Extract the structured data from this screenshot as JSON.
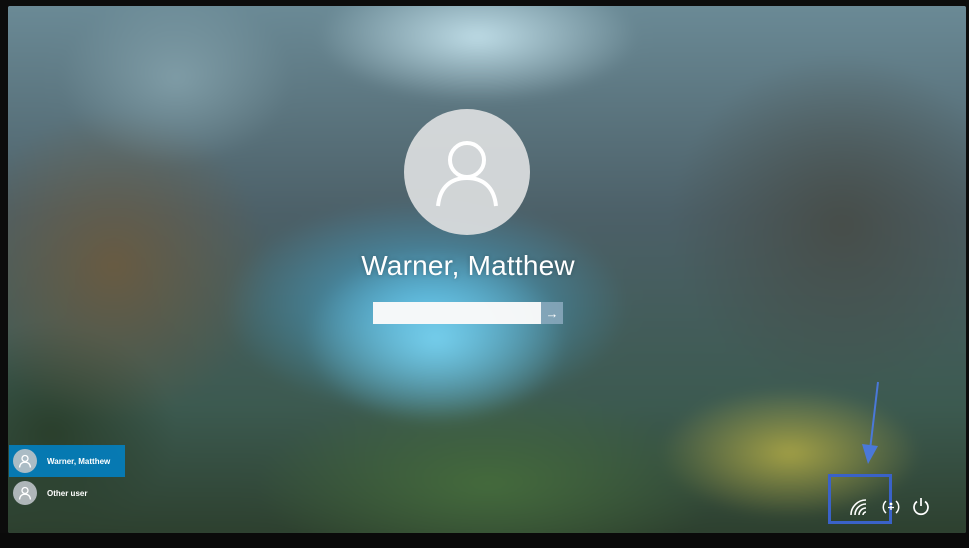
{
  "lock_screen": {
    "user_name": "Warner, Matthew",
    "password": {
      "placeholder": "",
      "value": "",
      "submit_icon": "arrow-right-icon"
    }
  },
  "user_list": {
    "items": [
      {
        "label": "Warner, Matthew",
        "selected": true,
        "icon": "user-icon"
      },
      {
        "label": "Other user",
        "selected": false,
        "icon": "user-icon"
      }
    ]
  },
  "system_tray": {
    "icons": [
      "network-icon",
      "ease-of-access-icon",
      "power-icon"
    ]
  },
  "colors": {
    "selected_user_bg": "#0082c8",
    "highlight_box": "#3a62c8",
    "annotation_arrow": "#4a78d8"
  }
}
